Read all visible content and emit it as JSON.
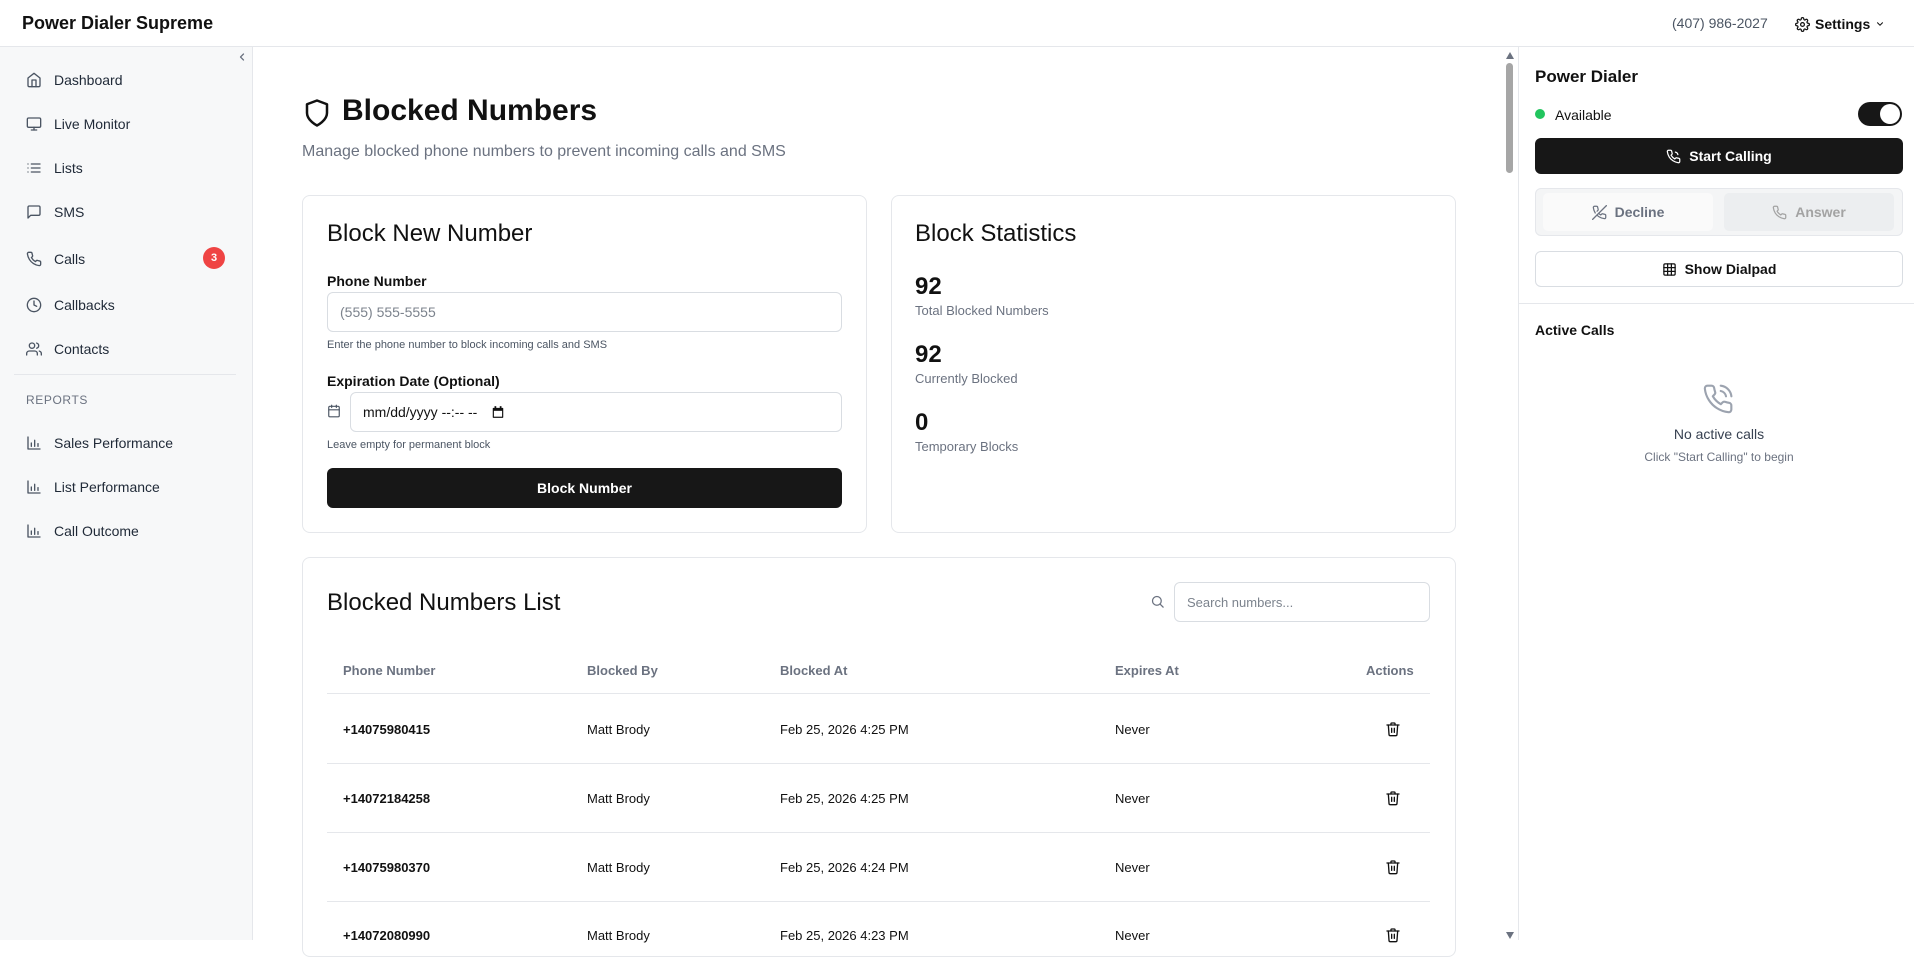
{
  "app": {
    "title": "Power Dialer Supreme",
    "phone": "(407) 986-2027",
    "settings_label": "Settings"
  },
  "sidebar": {
    "collapse_icon": "chevron-left-icon",
    "items": [
      {
        "label": "Dashboard",
        "icon": "home-icon"
      },
      {
        "label": "Live Monitor",
        "icon": "monitor-icon"
      },
      {
        "label": "Lists",
        "icon": "list-icon"
      },
      {
        "label": "SMS",
        "icon": "message-icon"
      },
      {
        "label": "Calls",
        "icon": "phone-icon",
        "badge": "3"
      },
      {
        "label": "Callbacks",
        "icon": "clock-icon"
      },
      {
        "label": "Contacts",
        "icon": "users-icon"
      }
    ],
    "reports_heading": "REPORTS",
    "reports": [
      {
        "label": "Sales Performance",
        "icon": "bar-chart-icon"
      },
      {
        "label": "List Performance",
        "icon": "bar-chart-icon"
      },
      {
        "label": "Call Outcome",
        "icon": "bar-chart-icon"
      }
    ]
  },
  "page": {
    "icon": "shield-icon",
    "title": "Blocked Numbers",
    "subtitle": "Manage blocked phone numbers to prevent incoming calls and SMS"
  },
  "block_form": {
    "title": "Block New Number",
    "phone_label": "Phone Number",
    "phone_value": "",
    "phone_placeholder": "(555) 555-5555",
    "phone_help": "Enter the phone number to block incoming calls and SMS",
    "expiration_label": "Expiration Date (Optional)",
    "expiration_icon": "calendar-icon",
    "expiration_value": "mm/dd/yyyy --:-- --",
    "expiration_help": "Leave empty for permanent block",
    "submit_label": "Block Number"
  },
  "stats": {
    "title": "Block Statistics",
    "items": [
      {
        "value": "92",
        "label": "Total Blocked Numbers"
      },
      {
        "value": "92",
        "label": "Currently Blocked"
      },
      {
        "value": "0",
        "label": "Temporary Blocks"
      }
    ]
  },
  "blocked_list": {
    "title": "Blocked Numbers List",
    "search_icon": "search-icon",
    "search_placeholder": "Search numbers...",
    "search_value": "",
    "columns": [
      "Phone Number",
      "Blocked By",
      "Blocked At",
      "Expires At",
      "Actions"
    ],
    "rows": [
      {
        "phone": "+14075980415",
        "blocked_by": "Matt Brody",
        "blocked_at": "Feb 25, 2026 4:25 PM",
        "expires_at": "Never",
        "action_icon": "trash-icon"
      },
      {
        "phone": "+14072184258",
        "blocked_by": "Matt Brody",
        "blocked_at": "Feb 25, 2026 4:25 PM",
        "expires_at": "Never",
        "action_icon": "trash-icon"
      },
      {
        "phone": "+14075980370",
        "blocked_by": "Matt Brody",
        "blocked_at": "Feb 25, 2026 4:24 PM",
        "expires_at": "Never",
        "action_icon": "trash-icon"
      },
      {
        "phone": "+14072080990",
        "blocked_by": "Matt Brody",
        "blocked_at": "Feb 25, 2026 4:23 PM",
        "expires_at": "Never",
        "action_icon": "trash-icon"
      }
    ]
  },
  "power_dialer": {
    "title": "Power Dialer",
    "status": "Available",
    "status_color": "#22c55e",
    "toggle_on": true,
    "start_label": "Start Calling",
    "decline_label": "Decline",
    "answer_label": "Answer",
    "dialpad_label": "Show Dialpad",
    "active_calls_title": "Active Calls",
    "empty_title": "No active calls",
    "empty_subtitle": "Click \"Start Calling\" to begin"
  },
  "colors": {
    "accent_dark": "#171717",
    "badge_red": "#ef4444",
    "available_green": "#22c55e",
    "sidebar_bg": "#f7f8f9"
  }
}
